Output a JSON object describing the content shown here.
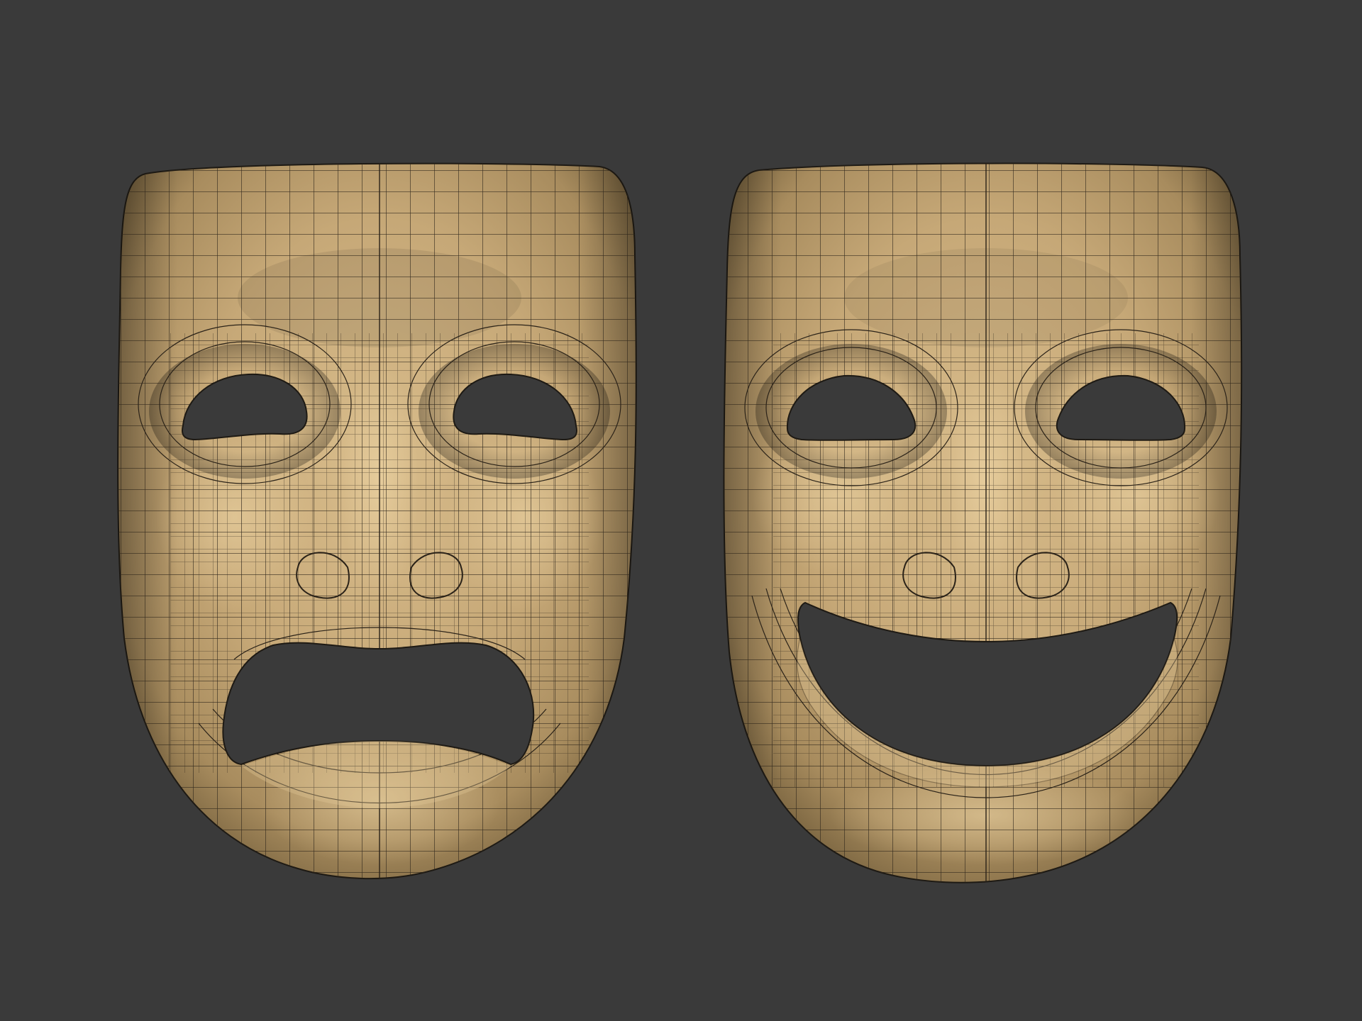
{
  "scene": {
    "background_color": "#3a3a3a",
    "material_color": "#c7aa7b",
    "wire_color": "#2a2218",
    "objects": [
      {
        "name": "tragedy-mask",
        "expression": "sad"
      },
      {
        "name": "comedy-mask",
        "expression": "happy"
      }
    ]
  }
}
